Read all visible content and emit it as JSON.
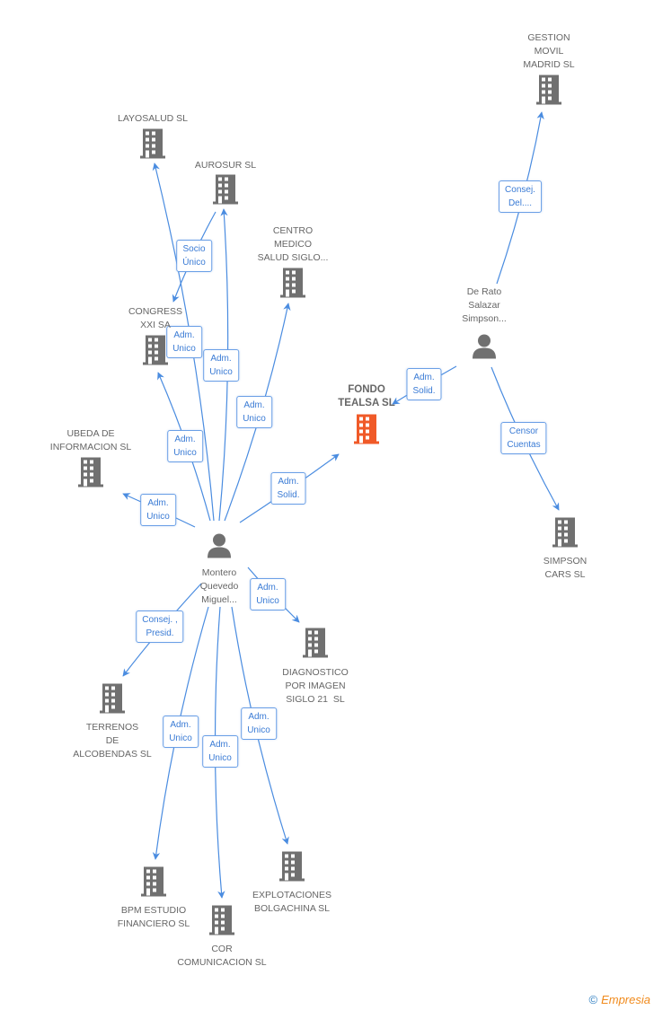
{
  "colors": {
    "edge": "#4a8ce0",
    "building": "#707070",
    "focus_building": "#f05a28",
    "person": "#707070"
  },
  "nodes": [
    {
      "id": "gestion",
      "type": "company",
      "label": "GESTION\nMOVIL\nMADRID SL"
    },
    {
      "id": "layosalud",
      "type": "company",
      "label": "LAYOSALUD SL"
    },
    {
      "id": "aurosur",
      "type": "company",
      "label": "AUROSUR SL"
    },
    {
      "id": "centro",
      "type": "company",
      "label": "CENTRO\nMEDICO\nSALUD SIGLO..."
    },
    {
      "id": "congress",
      "type": "company",
      "label": "CONGRESS\nXXI SA"
    },
    {
      "id": "ubeda",
      "type": "company",
      "label": "UBEDA DE\nINFORMACION SL"
    },
    {
      "id": "fondo",
      "type": "company",
      "focus": true,
      "label": "FONDO\nTEALSA SL"
    },
    {
      "id": "derato",
      "type": "person",
      "label": "De Rato\nSalazar\nSimpson..."
    },
    {
      "id": "simpson",
      "type": "company",
      "label": "SIMPSON\nCARS SL"
    },
    {
      "id": "montero",
      "type": "person",
      "label": "Montero\nQuevedo\nMiguel..."
    },
    {
      "id": "diagnostico",
      "type": "company",
      "label": "DIAGNOSTICO\nPOR IMAGEN\nSIGLO 21  SL"
    },
    {
      "id": "terrenos",
      "type": "company",
      "label": "TERRENOS\nDE\nALCOBENDAS SL"
    },
    {
      "id": "bpm",
      "type": "company",
      "label": "BPM ESTUDIO\nFINANCIERO SL"
    },
    {
      "id": "explotaciones",
      "type": "company",
      "label": "EXPLOTACIONES\nBOLGACHINA SL"
    },
    {
      "id": "cor",
      "type": "company",
      "label": "COR\nCOMUNICACION SL"
    }
  ],
  "edges": [
    {
      "from": "montero",
      "to": "layosalud",
      "label": "Adm.\nUnico"
    },
    {
      "from": "montero",
      "to": "aurosur",
      "label": "Adm.\nUnico"
    },
    {
      "from": "aurosur",
      "to": "congress",
      "label": "Socio\nÚnico"
    },
    {
      "from": "montero",
      "to": "congress",
      "label": "Adm.\nUnico"
    },
    {
      "from": "montero",
      "to": "centro",
      "label": "Adm.\nUnico"
    },
    {
      "from": "montero",
      "to": "ubeda",
      "label": "Adm.\nUnico"
    },
    {
      "from": "montero",
      "to": "fondo",
      "label": "Adm.\nSolid."
    },
    {
      "from": "montero",
      "to": "diagnostico",
      "label": "Adm.\nUnico"
    },
    {
      "from": "montero",
      "to": "terrenos",
      "label": "Consej. ,\nPresid."
    },
    {
      "from": "montero",
      "to": "bpm",
      "label": "Adm.\nUnico"
    },
    {
      "from": "montero",
      "to": "cor",
      "label": "Adm.\nUnico"
    },
    {
      "from": "montero",
      "to": "explotaciones",
      "label": "Adm.\nUnico"
    },
    {
      "from": "derato",
      "to": "gestion",
      "label": "Consej.\nDel...."
    },
    {
      "from": "derato",
      "to": "fondo",
      "label": "Adm.\nSolid."
    },
    {
      "from": "derato",
      "to": "simpson",
      "label": "Censor\nCuentas"
    }
  ],
  "footer": {
    "copyright_symbol": "©",
    "brand": "Empresia"
  }
}
